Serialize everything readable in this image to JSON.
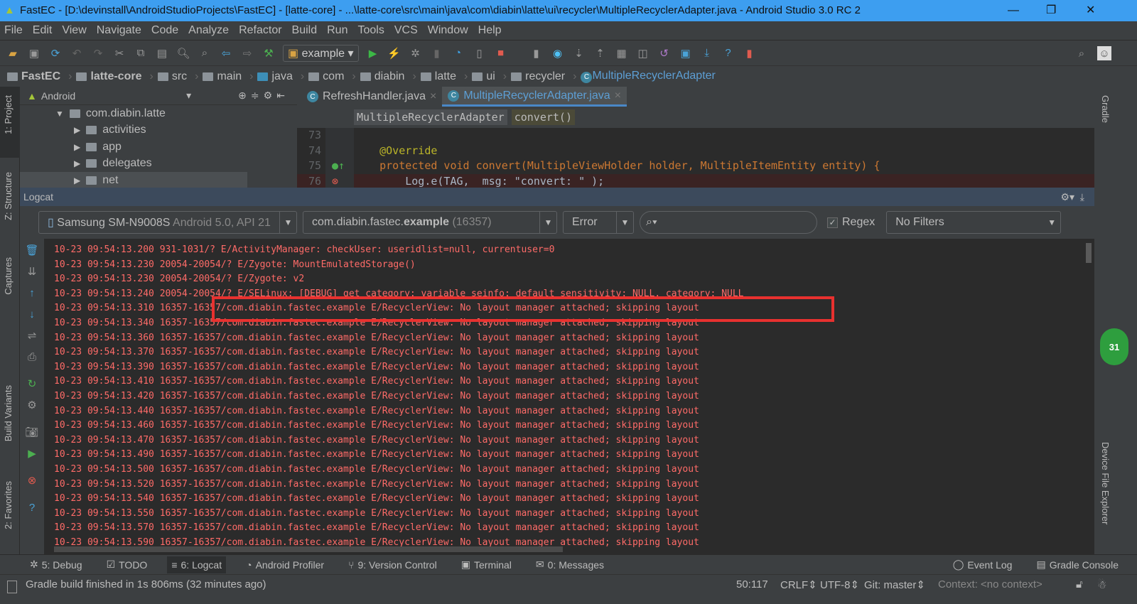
{
  "window": {
    "title": "FastEC - [D:\\devinstall\\AndroidStudioProjects\\FastEC] - [latte-core] - ...\\latte-core\\src\\main\\java\\com\\diabin\\latte\\ui\\recycler\\MultipleRecyclerAdapter.java - Android Studio 3.0 RC 2"
  },
  "menu": [
    "File",
    "Edit",
    "View",
    "Navigate",
    "Code",
    "Analyze",
    "Refactor",
    "Build",
    "Run",
    "Tools",
    "VCS",
    "Window",
    "Help"
  ],
  "toolbar": {
    "run_config": "example"
  },
  "breadcrumbs": [
    "FastEC",
    "latte-core",
    "src",
    "main",
    "java",
    "com",
    "diabin",
    "latte",
    "ui",
    "recycler",
    "MultipleRecyclerAdapter"
  ],
  "left_strip": {
    "project": "1: Project",
    "structure": "Z: Structure",
    "captures": "Captures",
    "build_variants": "Build Variants",
    "favorites": "2: Favorites"
  },
  "right_strip": {
    "gradle": "Gradle",
    "device_explorer": "Device File Explorer",
    "badge": "31"
  },
  "project": {
    "view": "Android",
    "items": [
      "com.diabin.latte",
      "activities",
      "app",
      "delegates",
      "net"
    ]
  },
  "editor": {
    "tabs": [
      "RefreshHandler.java",
      "MultipleRecyclerAdapter.java"
    ],
    "nav": [
      "MultipleRecyclerAdapter",
      "convert()"
    ],
    "lines": [
      {
        "n": "73",
        "code": ""
      },
      {
        "n": "74",
        "code": "    @Override"
      },
      {
        "n": "75",
        "code": "    protected void convert(MultipleViewHolder holder, MultipleItemEntity entity) {"
      },
      {
        "n": "76",
        "code": "        Log.e(TAG,  msg: \"convert: \" );"
      }
    ]
  },
  "logcat": {
    "title": "Logcat",
    "device": "Samsung SM-N9008S",
    "device_detail": "Android 5.0, API 21",
    "process_prefix": "com.diabin.fastec.",
    "process_bold": "example",
    "process_pid": "(16357)",
    "level": "Error",
    "search_placeholder": "",
    "regex_label": "Regex",
    "regex_checked": true,
    "filter": "No Filters",
    "lines": [
      "10-23 09:54:13.200 931-1031/? E/ActivityManager: checkUser: useridlist=null, currentuser=0",
      "10-23 09:54:13.230 20054-20054/? E/Zygote: MountEmulatedStorage()",
      "10-23 09:54:13.230 20054-20054/? E/Zygote: v2",
      "10-23 09:54:13.240 20054-20054/? E/SELinux: [DEBUG] get_category: variable seinfo: default sensitivity: NULL, category: NULL",
      "10-23 09:54:13.310 16357-16357/com.diabin.fastec.example E/RecyclerView: No layout manager attached; skipping layout",
      "10-23 09:54:13.340 16357-16357/com.diabin.fastec.example E/RecyclerView: No layout manager attached; skipping layout",
      "10-23 09:54:13.360 16357-16357/com.diabin.fastec.example E/RecyclerView: No layout manager attached; skipping layout",
      "10-23 09:54:13.370 16357-16357/com.diabin.fastec.example E/RecyclerView: No layout manager attached; skipping layout",
      "10-23 09:54:13.390 16357-16357/com.diabin.fastec.example E/RecyclerView: No layout manager attached; skipping layout",
      "10-23 09:54:13.410 16357-16357/com.diabin.fastec.example E/RecyclerView: No layout manager attached; skipping layout",
      "10-23 09:54:13.420 16357-16357/com.diabin.fastec.example E/RecyclerView: No layout manager attached; skipping layout",
      "10-23 09:54:13.440 16357-16357/com.diabin.fastec.example E/RecyclerView: No layout manager attached; skipping layout",
      "10-23 09:54:13.460 16357-16357/com.diabin.fastec.example E/RecyclerView: No layout manager attached; skipping layout",
      "10-23 09:54:13.470 16357-16357/com.diabin.fastec.example E/RecyclerView: No layout manager attached; skipping layout",
      "10-23 09:54:13.490 16357-16357/com.diabin.fastec.example E/RecyclerView: No layout manager attached; skipping layout",
      "10-23 09:54:13.500 16357-16357/com.diabin.fastec.example E/RecyclerView: No layout manager attached; skipping layout",
      "10-23 09:54:13.520 16357-16357/com.diabin.fastec.example E/RecyclerView: No layout manager attached; skipping layout",
      "10-23 09:54:13.540 16357-16357/com.diabin.fastec.example E/RecyclerView: No layout manager attached; skipping layout",
      "10-23 09:54:13.550 16357-16357/com.diabin.fastec.example E/RecyclerView: No layout manager attached; skipping layout",
      "10-23 09:54:13.570 16357-16357/com.diabin.fastec.example E/RecyclerView: No layout manager attached; skipping layout",
      "10-23 09:54:13.590 16357-16357/com.diabin.fastec.example E/RecyclerView: No layout manager attached; skipping layout"
    ]
  },
  "bottom_tabs": [
    "5: Debug",
    "TODO",
    "6: Logcat",
    "Android Profiler",
    "9: Version Control",
    "Terminal",
    "0: Messages",
    "Event Log",
    "Gradle Console"
  ],
  "status": {
    "message": "Gradle build finished in 1s 806ms (32 minutes ago)",
    "position": "50:117",
    "line_sep": "CRLF",
    "encoding": "UTF-8",
    "git": "Git: master",
    "context": "Context: <no context>"
  },
  "colors": {
    "title_bar": "#3d9ef0",
    "log_error": "#ff6b68",
    "highlight_box": "#e8312f"
  }
}
